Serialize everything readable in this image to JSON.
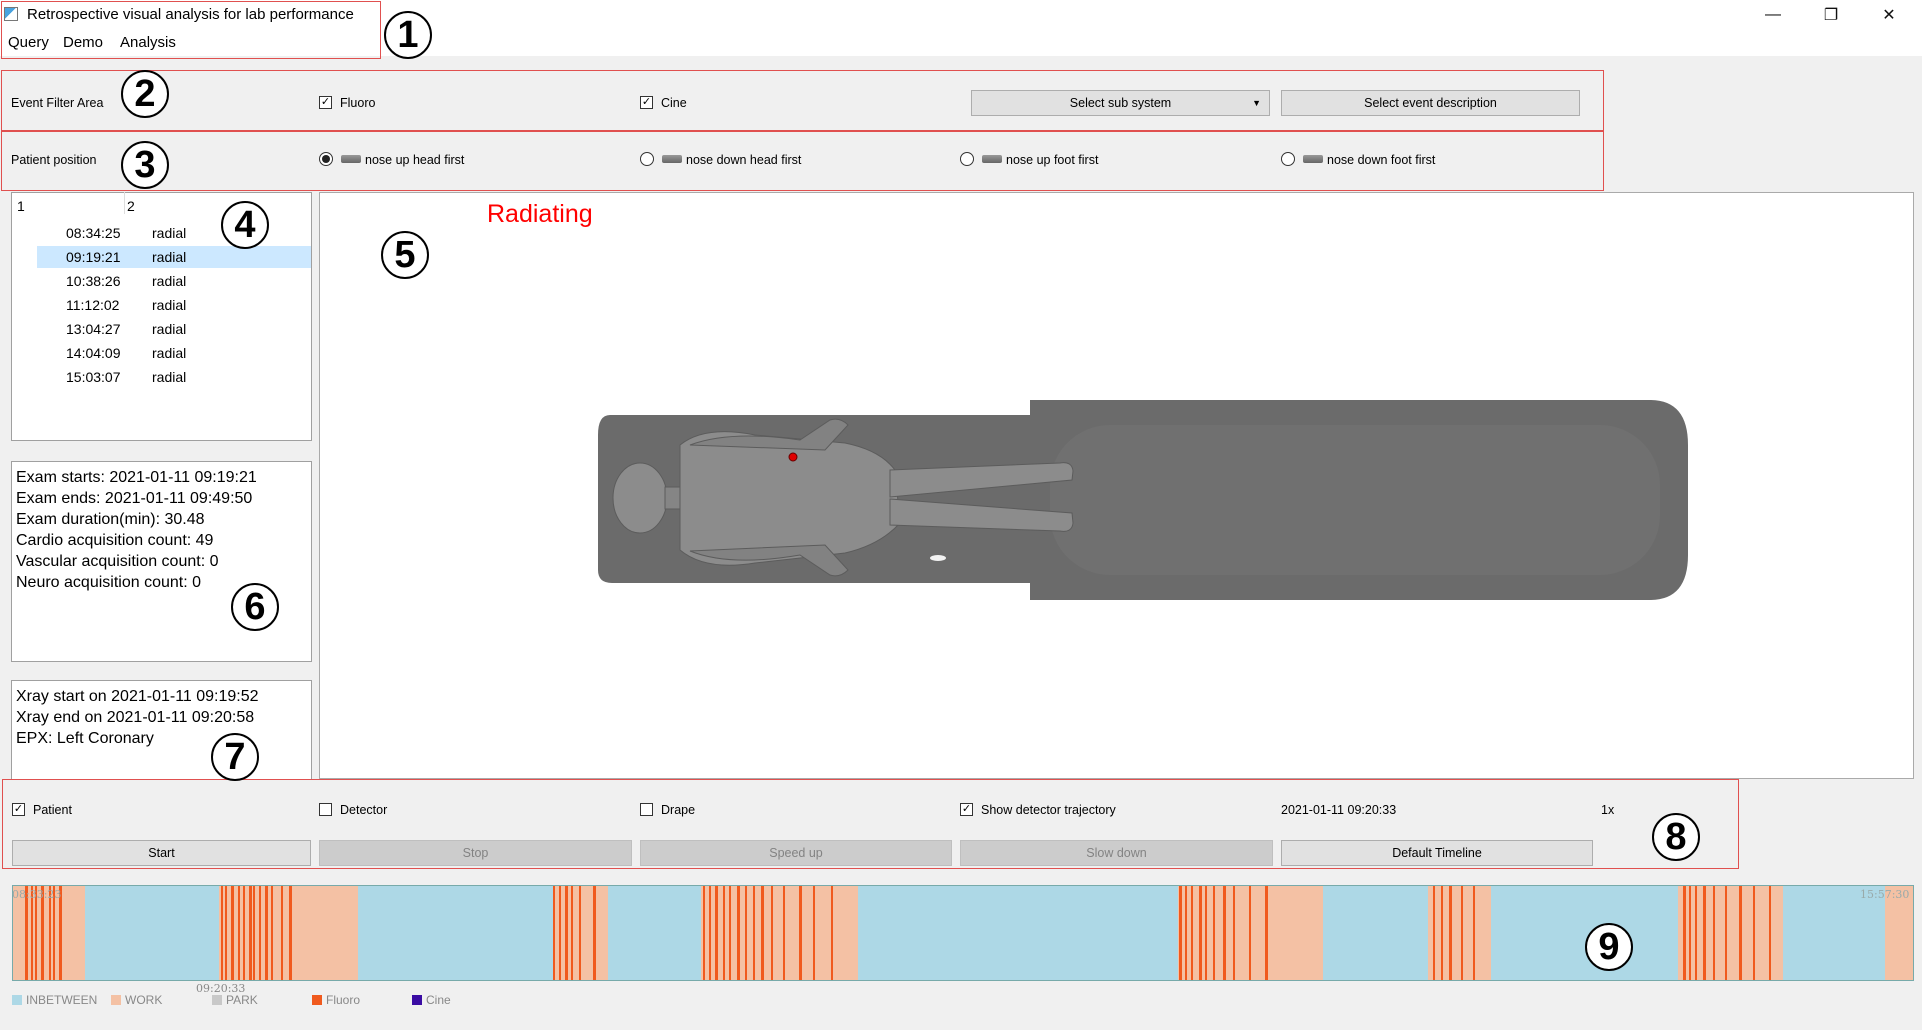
{
  "window": {
    "title": "Retrospective visual analysis for lab performance",
    "minimize_glyph": "—",
    "maximize_glyph": "❐",
    "close_glyph": "✕"
  },
  "menu": [
    "Query",
    "Demo",
    "Analysis"
  ],
  "callouts": [
    "1",
    "2",
    "3",
    "4",
    "5",
    "6",
    "7",
    "8",
    "9"
  ],
  "event_filter": {
    "label": "Event Filter Area",
    "fluoro": {
      "label": "Fluoro",
      "checked": true
    },
    "cine": {
      "label": "Cine",
      "checked": true
    },
    "subsystem_button": "Select sub system",
    "event_desc_button": "Select event description"
  },
  "patient_position": {
    "label": "Patient position",
    "options": [
      {
        "label": "nose up head first",
        "selected": true
      },
      {
        "label": "nose down head first",
        "selected": false
      },
      {
        "label": "nose up foot first",
        "selected": false
      },
      {
        "label": "nose down foot first",
        "selected": false
      }
    ]
  },
  "exam_list": {
    "headers": [
      "1",
      "2"
    ],
    "rows": [
      {
        "time": "08:34:25",
        "type": "radial",
        "selected": false
      },
      {
        "time": "09:19:21",
        "type": "radial",
        "selected": true
      },
      {
        "time": "10:38:26",
        "type": "radial",
        "selected": false
      },
      {
        "time": "11:12:02",
        "type": "radial",
        "selected": false
      },
      {
        "time": "13:04:27",
        "type": "radial",
        "selected": false
      },
      {
        "time": "14:04:09",
        "type": "radial",
        "selected": false
      },
      {
        "time": "15:03:07",
        "type": "radial",
        "selected": false
      }
    ]
  },
  "viewer": {
    "status": "Radiating",
    "status_color": "#ff0000"
  },
  "exam_info": [
    "Exam starts: 2021-01-11 09:19:21",
    "Exam ends: 2021-01-11 09:49:50",
    "Exam duration(min): 30.48",
    "Cardio acquisition count: 49",
    "Vascular acquisition count: 0",
    "Neuro acquisition count: 0"
  ],
  "xray_info": [
    "Xray start on 2021-01-11 09:19:52",
    "Xray end on 2021-01-11 09:20:58",
    "EPX: Left Coronary"
  ],
  "controls": {
    "patient": {
      "label": "Patient",
      "checked": true
    },
    "detector": {
      "label": "Detector",
      "checked": false
    },
    "drape": {
      "label": "Drape",
      "checked": false
    },
    "trajectory": {
      "label": "Show detector trajectory",
      "checked": true
    },
    "timestamp": "2021-01-11 09:20:33",
    "speed": "1x",
    "buttons": {
      "start": "Start",
      "stop": "Stop",
      "speed_up": "Speed up",
      "slow_down": "Slow down",
      "default_timeline": "Default Timeline"
    }
  },
  "timeline": {
    "start_label": "08:33:23",
    "end_label": "15:57:30",
    "cursor_label": "09:20:33",
    "legend": [
      {
        "label": "INBETWEEN",
        "color": "#add8e6"
      },
      {
        "label": "WORK",
        "color": "#f4c1a4"
      },
      {
        "label": "PARK",
        "color": "#c8c8c8"
      },
      {
        "label": "Fluoro",
        "color": "#f05a1e"
      },
      {
        "label": "Cine",
        "color": "#3a0ca3"
      }
    ]
  }
}
